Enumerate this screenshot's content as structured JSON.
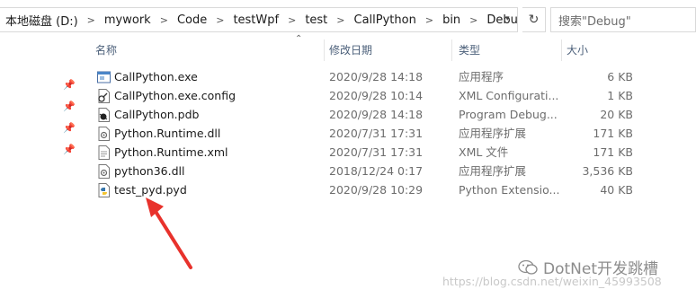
{
  "address": {
    "crumbs": [
      "本地磁盘 (D:)",
      "mywork",
      "Code",
      "testWpf",
      "test",
      "CallPython",
      "bin",
      "Debug"
    ],
    "search_placeholder": "搜索\"Debug\""
  },
  "columns": {
    "name": "名称",
    "date": "修改日期",
    "type": "类型",
    "size": "大小"
  },
  "files": [
    {
      "name": "CallPython.exe",
      "date": "2020/9/28 14:18",
      "type": "应用程序",
      "size": "6 KB",
      "icon": "exe-icon"
    },
    {
      "name": "CallPython.exe.config",
      "date": "2020/9/28 10:14",
      "type": "XML Configurati...",
      "size": "1 KB",
      "icon": "config-file-icon"
    },
    {
      "name": "CallPython.pdb",
      "date": "2020/9/28 14:18",
      "type": "Program Debug...",
      "size": "20 KB",
      "icon": "pdb-file-icon"
    },
    {
      "name": "Python.Runtime.dll",
      "date": "2020/7/31 17:31",
      "type": "应用程序扩展",
      "size": "171 KB",
      "icon": "dll-file-icon"
    },
    {
      "name": "Python.Runtime.xml",
      "date": "2020/7/31 17:31",
      "type": "XML 文件",
      "size": "171 KB",
      "icon": "xml-file-icon"
    },
    {
      "name": "python36.dll",
      "date": "2018/12/24 0:17",
      "type": "应用程序扩展",
      "size": "3,536 KB",
      "icon": "dll-file-icon"
    },
    {
      "name": "test_pyd.pyd",
      "date": "2020/9/28 10:29",
      "type": "Python Extensio...",
      "size": "40 KB",
      "icon": "python-file-icon"
    }
  ],
  "watermark": {
    "brand": "DotNet开发跳槽",
    "url": "https://blog.csdn.net/weixin_45993508"
  },
  "colors": {
    "arrow": "#e8322c",
    "header_text": "#4c607a"
  }
}
